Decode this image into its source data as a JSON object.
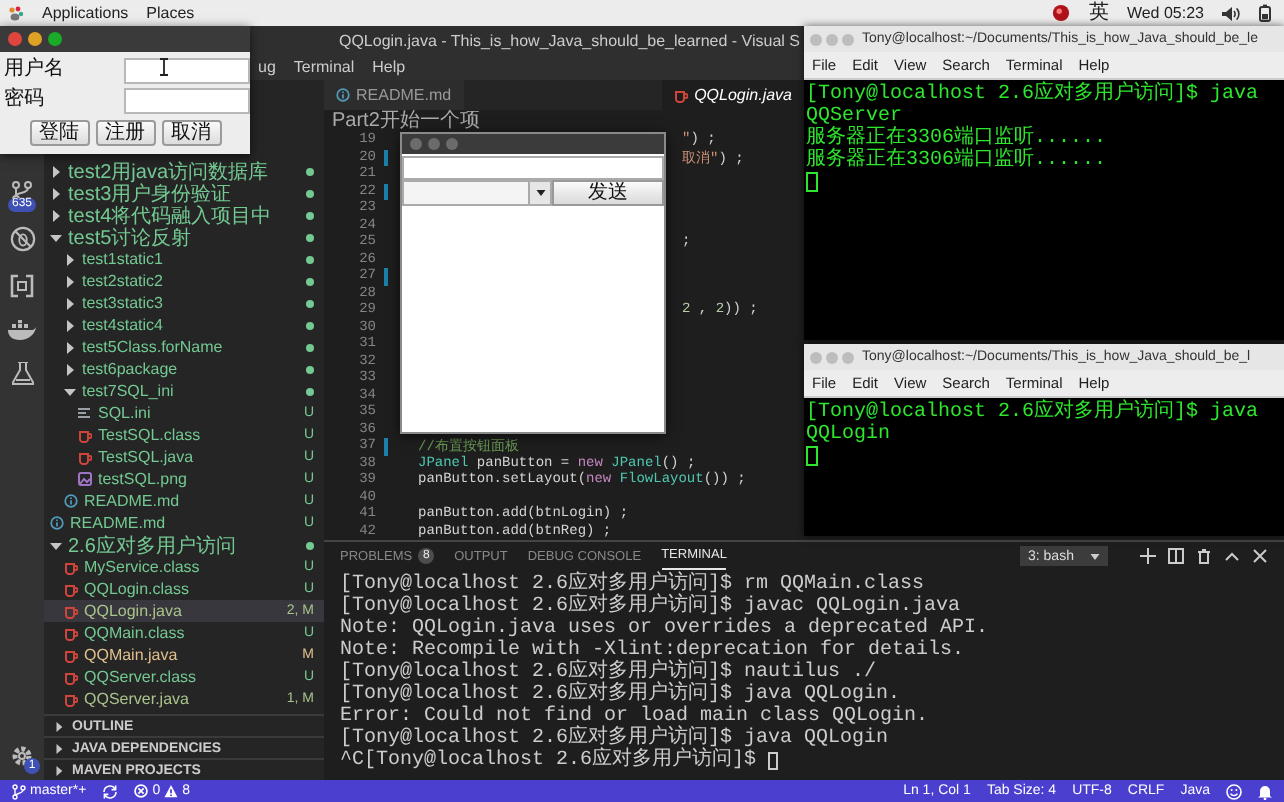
{
  "top_bar": {
    "menus": [
      "Applications",
      "Places"
    ],
    "input_method": "英",
    "clock": "Wed 05:23"
  },
  "editor_window": {
    "title": "QQLogin.java - This_is_how_Java_should_be_learned - Visual S",
    "menus": [
      "ug",
      "Terminal",
      "Help"
    ]
  },
  "activity_bar": {
    "items": [
      {
        "kind": "source-control",
        "badge": "635"
      },
      {
        "kind": "no-debug"
      },
      {
        "kind": "remote"
      },
      {
        "kind": "docker"
      },
      {
        "kind": "test"
      }
    ],
    "settings_badge": "1"
  },
  "sidebar": {
    "tree": [
      {
        "label": "test2用java访问数据库",
        "kind": "folder",
        "expanded": false,
        "dot": true,
        "color": "#73c991",
        "selected": false
      },
      {
        "label": "test3用户身份验证",
        "kind": "folder",
        "expanded": false,
        "dot": true,
        "color": "#73c991",
        "selected": false
      },
      {
        "label": "test4将代码融入项目中",
        "kind": "folder",
        "expanded": false,
        "dot": true,
        "color": "#73c991",
        "selected": false
      },
      {
        "label": "test5讨论反射",
        "kind": "folder",
        "expanded": true,
        "dot": true,
        "color": "#73c991",
        "selected": false,
        "children": [
          {
            "label": "test1static1",
            "kind": "folder",
            "expanded": false,
            "dot": true,
            "color": "#73c991",
            "selected": false
          },
          {
            "label": "test2static2",
            "kind": "folder",
            "expanded": false,
            "dot": true,
            "color": "#73c991",
            "selected": false
          },
          {
            "label": "test3static3",
            "kind": "folder",
            "expanded": false,
            "dot": true,
            "color": "#73c991",
            "selected": false
          },
          {
            "label": "test4static4",
            "kind": "folder",
            "expanded": false,
            "dot": true,
            "color": "#73c991",
            "selected": false
          },
          {
            "label": "test5Class.forName",
            "kind": "folder",
            "expanded": false,
            "dot": true,
            "color": "#73c991",
            "selected": false
          },
          {
            "label": "test6package",
            "kind": "folder",
            "expanded": false,
            "dot": true,
            "color": "#73c991",
            "selected": false
          },
          {
            "label": "test7SQL_ini",
            "kind": "folder",
            "expanded": true,
            "dot": true,
            "color": "#73c991",
            "selected": false,
            "children": [
              {
                "label": "SQL.ini",
                "kind": "config",
                "badge": "U",
                "color": "#73c991",
                "selected": false
              },
              {
                "label": "TestSQL.class",
                "kind": "java",
                "badge": "U",
                "color": "#73c991",
                "selected": false
              },
              {
                "label": "TestSQL.java",
                "kind": "java",
                "badge": "U",
                "color": "#73c991",
                "selected": false
              },
              {
                "label": "testSQL.png",
                "kind": "image",
                "badge": "U",
                "color": "#73c991",
                "selected": false
              }
            ]
          },
          {
            "label": "README.md",
            "kind": "markdown",
            "badge": "U",
            "color": "#73c991",
            "selected": false
          }
        ]
      },
      {
        "label": "README.md",
        "kind": "markdown",
        "badge": "U",
        "color": "#73c991",
        "selected": false
      },
      {
        "label": "2.6应对多用户访问",
        "kind": "folder",
        "expanded": true,
        "dot": true,
        "color": "#73c991",
        "selected": false,
        "children": [
          {
            "label": "MyService.class",
            "kind": "java",
            "badge": "U",
            "color": "#73c991",
            "selected": false
          },
          {
            "label": "QQLogin.class",
            "kind": "java",
            "badge": "U",
            "color": "#73c991",
            "selected": false
          },
          {
            "label": "QQLogin.java",
            "kind": "java",
            "badge": "2, M",
            "color": "#a9c48a",
            "selected": true
          },
          {
            "label": "QQMain.class",
            "kind": "java",
            "badge": "U",
            "color": "#73c991",
            "selected": false
          },
          {
            "label": "QQMain.java",
            "kind": "java",
            "badge": "M",
            "color": "#e2c08d",
            "selected": false
          },
          {
            "label": "QQServer.class",
            "kind": "java",
            "badge": "U",
            "color": "#73c991",
            "selected": false
          },
          {
            "label": "QQServer.java",
            "kind": "java",
            "badge": "1, M",
            "color": "#a9c48a",
            "selected": false
          }
        ]
      }
    ],
    "sections": [
      "OUTLINE",
      "JAVA DEPENDENCIES",
      "MAVEN PROJECTS"
    ]
  },
  "editor": {
    "tabs": [
      {
        "label": "README.md",
        "kind": "markdown",
        "selected": false
      },
      {
        "label": "QQLogin.java",
        "kind": "java",
        "selected": true
      }
    ],
    "breadcrumb": "Part2开始一个项",
    "lines": [
      {
        "number": "19",
        "changed": false,
        "kind": "tail",
        "tokens": [
          {
            "text": "\"",
            "kind": "string"
          },
          {
            "text": ") ;",
            "kind": "plain"
          }
        ]
      },
      {
        "number": "20",
        "changed": true,
        "kind": "tail",
        "tokens": [
          {
            "text": "取消\"",
            "kind": "string"
          },
          {
            "text": ") ;",
            "kind": "plain"
          }
        ]
      },
      {
        "number": "21",
        "changed": false
      },
      {
        "number": "22",
        "changed": true
      },
      {
        "number": "23",
        "changed": false
      },
      {
        "number": "24",
        "changed": false
      },
      {
        "number": "25",
        "changed": false,
        "kind": "tail",
        "tokens": [
          {
            "text": ";",
            "kind": "plain"
          }
        ]
      },
      {
        "number": "26",
        "changed": false
      },
      {
        "number": "27",
        "changed": true
      },
      {
        "number": "28",
        "changed": false
      },
      {
        "number": "29",
        "changed": false,
        "kind": "tail",
        "tokens": [
          {
            "text": "2",
            "kind": "number"
          },
          {
            "text": " , ",
            "kind": "plain"
          },
          {
            "text": "2",
            "kind": "number"
          },
          {
            "text": ")) ;",
            "kind": "plain"
          }
        ]
      },
      {
        "number": "30",
        "changed": false
      },
      {
        "number": "31",
        "changed": false
      },
      {
        "number": "32",
        "changed": false
      },
      {
        "number": "33",
        "changed": false
      },
      {
        "number": "34",
        "changed": false
      },
      {
        "number": "35",
        "changed": false
      },
      {
        "number": "36",
        "changed": false
      },
      {
        "number": "37",
        "changed": true,
        "kind": "full",
        "tokens": [
          {
            "text": "//布置按钮面板",
            "kind": "comment"
          }
        ]
      },
      {
        "number": "38",
        "changed": false,
        "kind": "full",
        "tokens": [
          {
            "text": "JPanel",
            "kind": "type"
          },
          {
            "text": " panButton = ",
            "kind": "plain"
          },
          {
            "text": "new ",
            "kind": "keyword"
          },
          {
            "text": "JPanel",
            "kind": "type"
          },
          {
            "text": "() ;",
            "kind": "plain"
          }
        ]
      },
      {
        "number": "39",
        "changed": false,
        "kind": "full",
        "tokens": [
          {
            "text": "panButton.setLayout(",
            "kind": "plain"
          },
          {
            "text": "new ",
            "kind": "keyword"
          },
          {
            "text": "FlowLayout",
            "kind": "type"
          },
          {
            "text": "()) ;",
            "kind": "plain"
          }
        ]
      },
      {
        "number": "40",
        "changed": false
      },
      {
        "number": "41",
        "changed": false,
        "kind": "full",
        "tokens": [
          {
            "text": "panButton.add(btnLogin) ;",
            "kind": "plain"
          }
        ]
      },
      {
        "number": "42",
        "changed": false,
        "kind": "full",
        "tokens": [
          {
            "text": "panButton.add(btnReg) ;",
            "kind": "plain"
          }
        ]
      }
    ]
  },
  "panel": {
    "tabs": [
      {
        "label": "PROBLEMS",
        "badge": "8",
        "selected": false
      },
      {
        "label": "OUTPUT",
        "selected": false
      },
      {
        "label": "DEBUG CONSOLE",
        "selected": false
      },
      {
        "label": "TERMINAL",
        "selected": true
      }
    ],
    "terminal_select": "3: bash",
    "lines": [
      "[Tony@localhost 2.6应对多用户访问]$ rm QQMain.class",
      "[Tony@localhost 2.6应对多用户访问]$ javac QQLogin.java",
      "Note: QQLogin.java uses or overrides a deprecated API.",
      "Note: Recompile with -Xlint:deprecation for details.",
      "[Tony@localhost 2.6应对多用户访问]$ nautilus ./",
      "[Tony@localhost 2.6应对多用户访问]$ java QQLogin.",
      "Error: Could not find or load main class QQLogin.",
      "[Tony@localhost 2.6应对多用户访问]$ java QQLogin",
      "^C[Tony@localhost 2.6应对多用户访问]$"
    ],
    "cursor": true
  },
  "status_bar": {
    "branch": "master*+",
    "errors": "0",
    "warnings": "8",
    "items": [
      "Ln 1, Col 1",
      "Tab Size: 4",
      "UTF-8",
      "CRLF",
      "Java"
    ]
  },
  "login_dialog": {
    "fields": [
      {
        "label": "用户名"
      },
      {
        "label": "密码"
      }
    ],
    "buttons": [
      "登陆",
      "注册",
      "取消"
    ]
  },
  "chat_window": {
    "send_button": "发送"
  },
  "terminals": [
    {
      "title": "Tony@localhost:~/Documents/This_is_how_Java_should_be_le",
      "menus": [
        "File",
        "Edit",
        "View",
        "Search",
        "Terminal",
        "Help"
      ],
      "lines": [
        "[Tony@localhost 2.6应对多用户访问]$ java QQServer",
        "服务器正在3306端口监听......",
        "服务器正在3306端口监听......"
      ],
      "cursor": true
    },
    {
      "title": "Tony@localhost:~/Documents/This_is_how_Java_should_be_l",
      "menus": [
        "File",
        "Edit",
        "View",
        "Search",
        "Terminal",
        "Help"
      ],
      "lines": [
        "[Tony@localhost 2.6应对多用户访问]$ java QQLogin"
      ],
      "cursor": true
    }
  ]
}
